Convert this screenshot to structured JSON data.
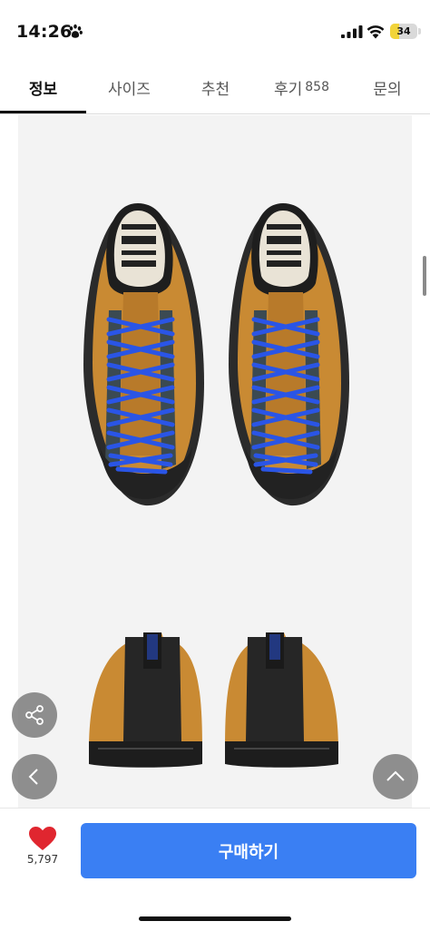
{
  "status_bar": {
    "time": "14:26",
    "battery": "34",
    "battery_level_percent": 34
  },
  "tabs": [
    {
      "label": "정보",
      "count": "",
      "active": true
    },
    {
      "label": "사이즈",
      "count": "",
      "active": false
    },
    {
      "label": "추천",
      "count": "",
      "active": false
    },
    {
      "label": "후기",
      "count": "858",
      "active": false
    },
    {
      "label": "문의",
      "count": "",
      "active": false
    }
  ],
  "product_image": {
    "icon_top": "shoe-pair-top-view",
    "icon_bottom": "shoe-pair-back-view",
    "colors": {
      "suede": "#c98a33",
      "laces": "#2a55e6",
      "sole": "#2a2a2a"
    }
  },
  "floating_buttons": {
    "share_icon": "share-icon",
    "prev_icon": "chevron-left-icon",
    "top_icon": "chevron-up-icon"
  },
  "bottom_bar": {
    "like_count": "5,797",
    "buy_label": "구매하기",
    "accent_color": "#3a7ff3",
    "heart_color": "#e0262f"
  }
}
